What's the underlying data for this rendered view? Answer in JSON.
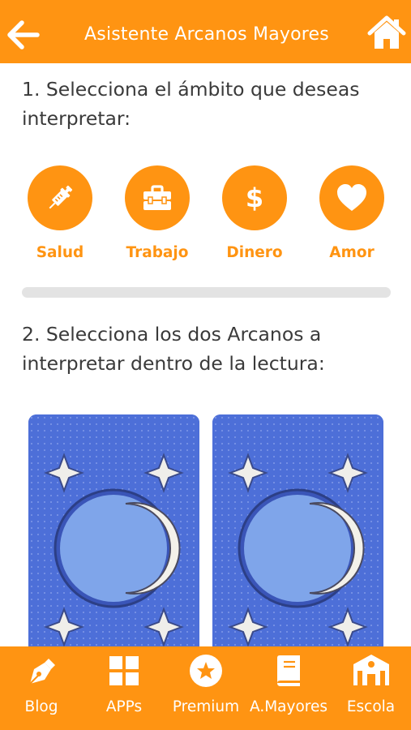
{
  "header": {
    "title": "Asistente Arcanos Mayores",
    "back_icon": "arrow-left-icon",
    "home_icon": "home-icon"
  },
  "step1": {
    "text": "1. Selecciona el ámbito que deseas interpretar:"
  },
  "scopes": [
    {
      "label": "Salud",
      "icon": "syringe-icon"
    },
    {
      "label": "Trabajo",
      "icon": "toolbox-icon"
    },
    {
      "label": "Dinero",
      "icon": "dollar-icon"
    },
    {
      "label": "Amor",
      "icon": "heart-icon"
    }
  ],
  "step2": {
    "text": "2. Selecciona los dos Arcanos a interpretar dentro de la lectura:"
  },
  "cards": [
    {
      "icon": "moon-card-back"
    },
    {
      "icon": "moon-card-back"
    }
  ],
  "tabbar": {
    "items": [
      {
        "label": "Blog",
        "icon": "pen-nib-icon"
      },
      {
        "label": "APPs",
        "icon": "grid-icon"
      },
      {
        "label": "Premium",
        "icon": "star-badge-icon"
      },
      {
        "label": "A.Mayores",
        "icon": "book-icon"
      },
      {
        "label": "Escola",
        "icon": "school-icon"
      }
    ]
  },
  "colors": {
    "accent": "#ff9412",
    "card_blue": "#4d6fd8",
    "text": "#3a3a3a",
    "divider": "#e3e3e3"
  }
}
